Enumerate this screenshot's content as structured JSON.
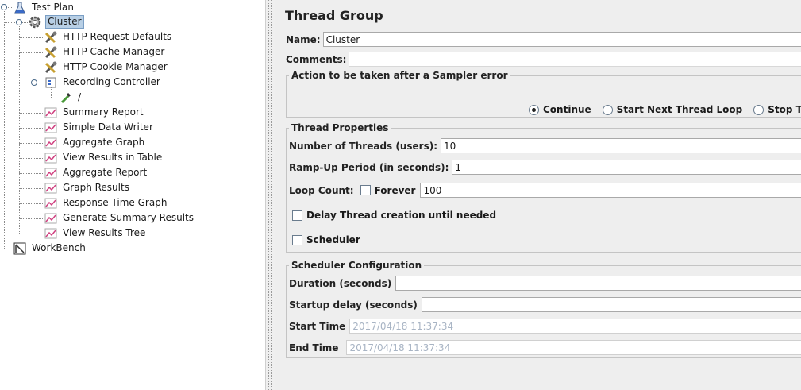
{
  "tree": {
    "root": "Test Plan",
    "thread_group": "Cluster",
    "items": [
      "HTTP Request Defaults",
      "HTTP Cache Manager",
      "HTTP Cookie Manager",
      "Recording Controller",
      "/",
      "Summary Report",
      "Simple Data Writer",
      "Aggregate Graph",
      "View Results in Table",
      "Aggregate Report",
      "Graph Results",
      "Response Time Graph",
      "Generate Summary Results",
      "View Results Tree"
    ],
    "workbench": "WorkBench"
  },
  "panel": {
    "title": "Thread Group",
    "name_label": "Name:",
    "name_value": "Cluster",
    "comments_label": "Comments:",
    "comments_value": "",
    "error_group": {
      "legend": "Action to be taken after a Sampler error",
      "options": [
        "Continue",
        "Start Next Thread Loop",
        "Stop Thread"
      ],
      "selected": "Continue"
    },
    "thread_props": {
      "legend": "Thread Properties",
      "threads_label": "Number of Threads (users):",
      "threads_value": "10",
      "rampup_label": "Ramp-Up Period (in seconds):",
      "rampup_value": "1",
      "loop_label": "Loop Count:",
      "forever_label": "Forever",
      "loop_value": "100",
      "delay_label": "Delay Thread creation until needed",
      "scheduler_label": "Scheduler"
    },
    "scheduler_config": {
      "legend": "Scheduler Configuration",
      "duration_label": "Duration (seconds)",
      "duration_value": "",
      "startup_label": "Startup delay (seconds)",
      "startup_value": "",
      "start_label": "Start Time",
      "start_value": "2017/04/18 11:37:34",
      "end_label": "End Time",
      "end_value": "2017/04/18 11:37:34"
    }
  }
}
